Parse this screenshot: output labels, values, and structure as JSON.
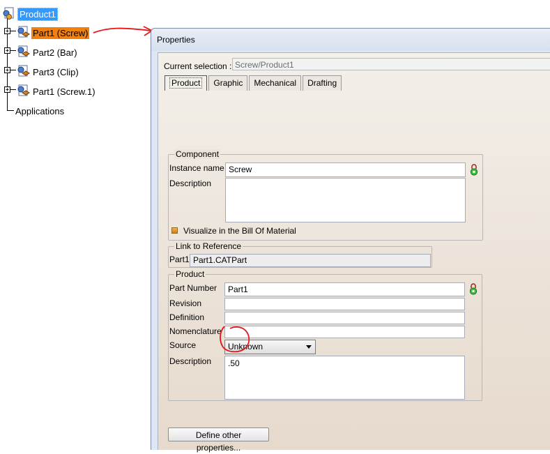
{
  "tree": {
    "root": "Product1",
    "children": [
      {
        "label": "Part1 (Screw)"
      },
      {
        "label": "Part2 (Bar)"
      },
      {
        "label": "Part3 (Clip)"
      },
      {
        "label": "Part1 (Screw.1)"
      }
    ],
    "applications": "Applications"
  },
  "dialog": {
    "title": "Properties",
    "current_selection_label": "Current selection :",
    "current_selection_value": "Screw/Product1",
    "tabs": [
      "Product",
      "Graphic",
      "Mechanical",
      "Drafting"
    ],
    "active_tab": "Product",
    "component": {
      "title": "Component",
      "instance_name_label": "Instance name",
      "instance_name_value": "Screw",
      "description_label": "Description",
      "description_value": "",
      "visualize_bom_label": "Visualize in the Bill Of Material",
      "visualize_bom_checked": true
    },
    "link_to_reference": {
      "title": "Link to Reference",
      "part_label": "Part1",
      "part_value": "Part1.CATPart"
    },
    "product": {
      "title": "Product",
      "part_number_label": "Part Number",
      "part_number_value": "Part1",
      "revision_label": "Revision",
      "revision_value": "",
      "definition_label": "Definition",
      "definition_value": "",
      "nomenclature_label": "Nomenclature",
      "nomenclature_value": "",
      "source_label": "Source",
      "source_value": "Unknown",
      "description_label": "Description",
      "description_value": ".50"
    },
    "define_other_properties_label": "Define other properties..."
  },
  "colors": {
    "tree_selection": "#f08010",
    "root_highlight": "#3399ff",
    "annotation_red": "#e8141a"
  },
  "icons": {
    "product": "product-icon",
    "part": "part-icon",
    "lock": "lock-icon"
  }
}
